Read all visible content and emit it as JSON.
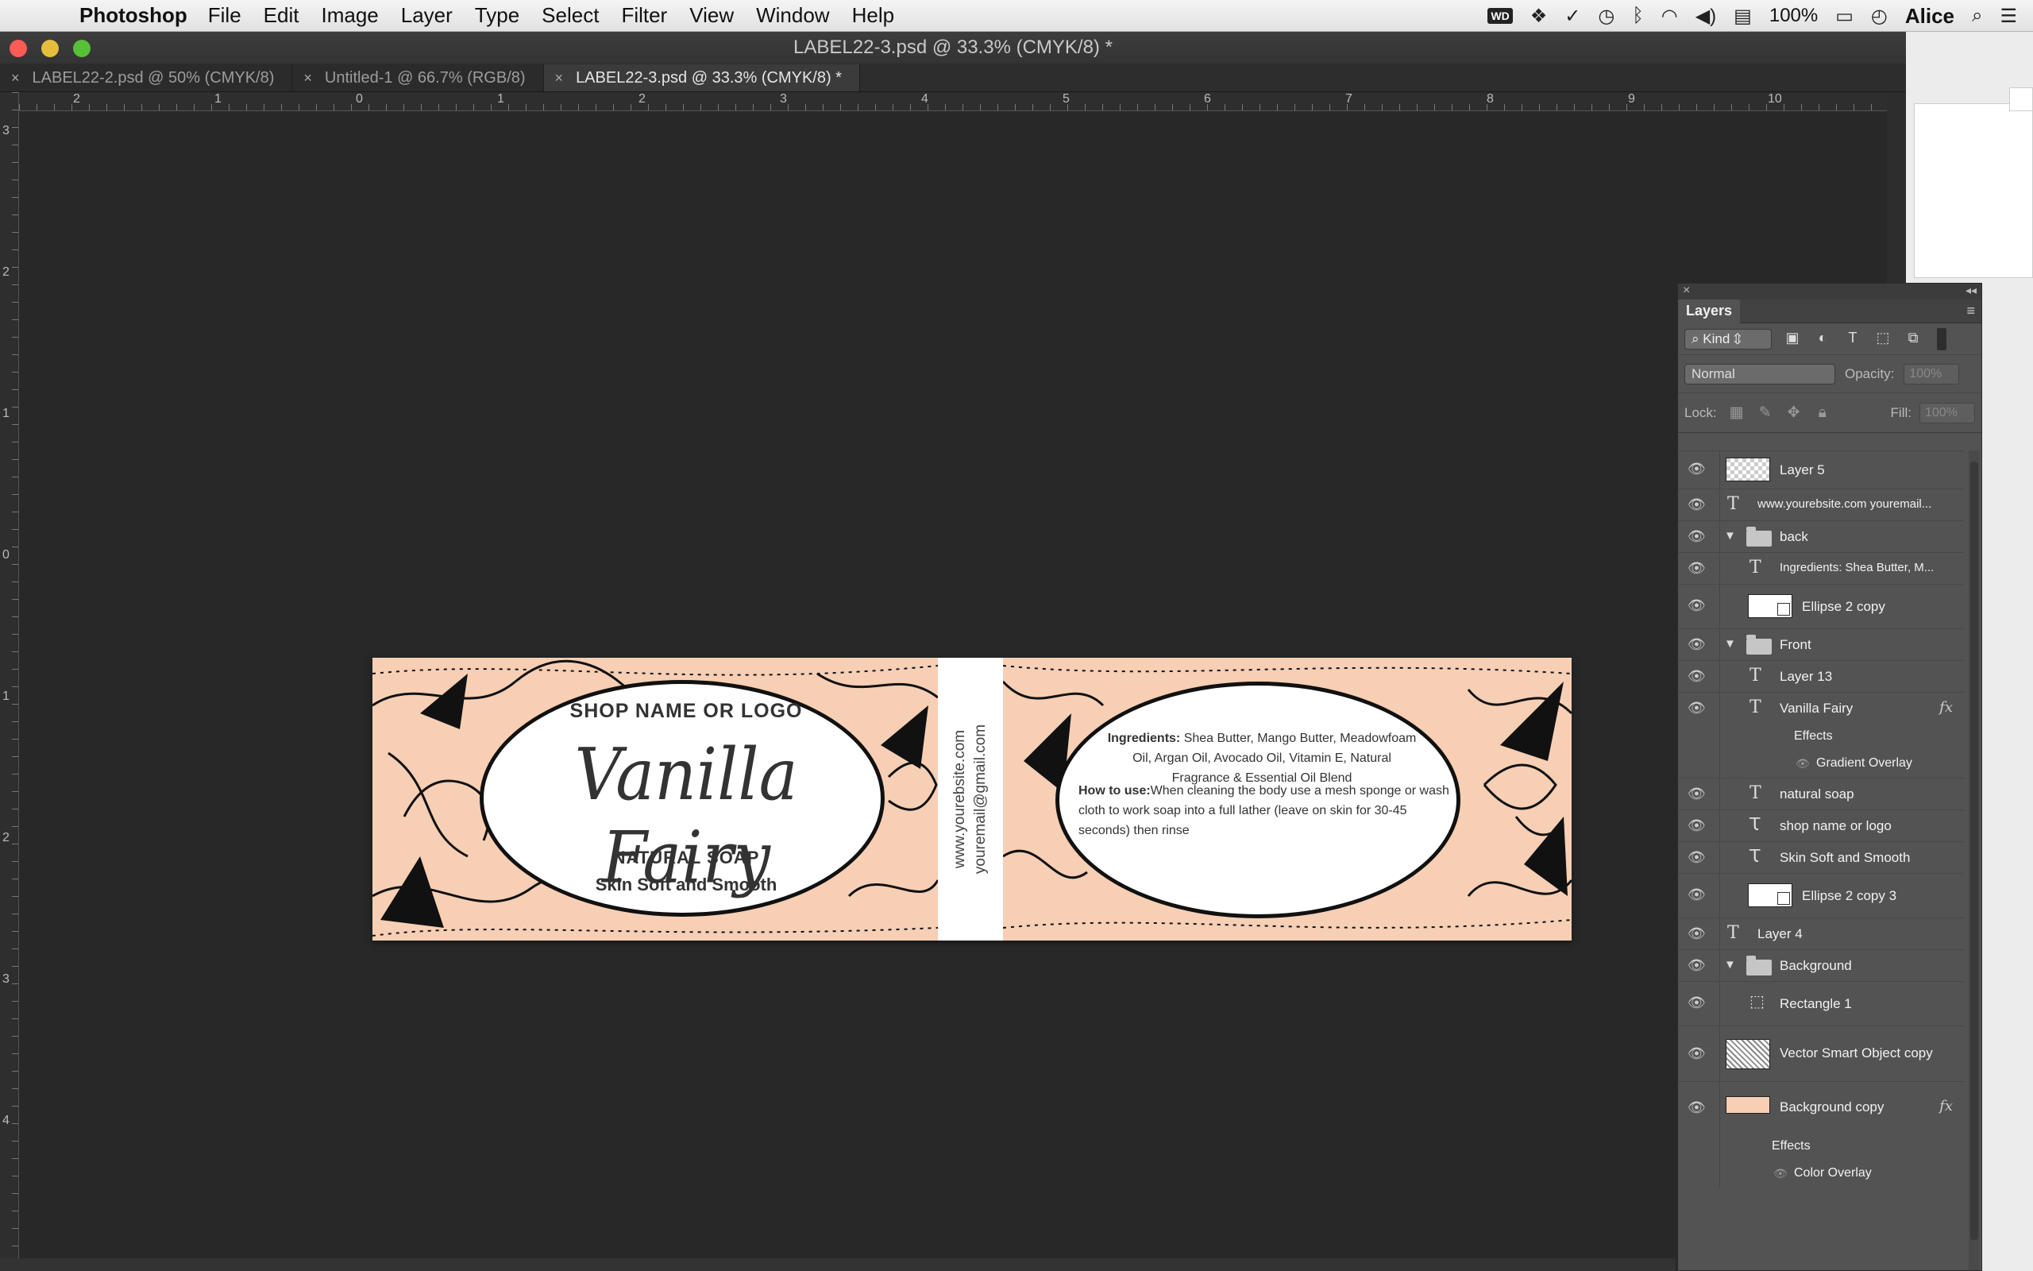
{
  "menubar": {
    "app_name": "Photoshop",
    "menus": [
      "File",
      "Edit",
      "Image",
      "Layer",
      "Type",
      "Select",
      "Filter",
      "View",
      "Window",
      "Help"
    ],
    "status": {
      "wd_badge": "WD",
      "battery": "100%",
      "user": "Alice"
    }
  },
  "window": {
    "title": "LABEL22-3.psd @ 33.3% (CMYK/8) *"
  },
  "tabs": [
    {
      "label": "LABEL22-2.psd @ 50% (CMYK/8)"
    },
    {
      "label": "Untitled-1 @ 66.7% (RGB/8)"
    },
    {
      "label": "LABEL22-3.psd @ 33.3% (CMYK/8) *"
    }
  ],
  "rulers": {
    "top": [
      "2",
      "1",
      "0",
      "1",
      "2",
      "3",
      "4",
      "5",
      "6",
      "7",
      "8",
      "9",
      "10"
    ],
    "left": [
      "3",
      "2",
      "1",
      "0",
      "1",
      "2",
      "3",
      "4"
    ]
  },
  "label": {
    "front": {
      "shop_name": "SHOP NAME OR LOGO",
      "product_name": "Vanilla Fairy",
      "soap_type": "NATURAL SOAP",
      "tagline": "Skin Soft and Smooth"
    },
    "spine": {
      "website": "www.yourebsite.com",
      "email": "youremail@gmail.com"
    },
    "back": {
      "ingredients_label": "Ingredients:",
      "ingredients_text": " Shea Butter, Mango Butter, Meadowfoam Oil, Argan Oil, Avocado Oil, Vitamin E, Natural Fragrance & Essential Oil Blend",
      "how_to_label": "How to use:",
      "how_to_text": "When cleaning the body use a mesh sponge or wash cloth to work soap into a full lather (leave on skin for 30-45 seconds) then rinse"
    }
  },
  "layers_panel": {
    "title": "Layers",
    "filter_kind": "Kind",
    "blend_mode": "Normal",
    "opacity_label": "Opacity:",
    "opacity_value": "100%",
    "lock_label": "Lock:",
    "fill_label": "Fill:",
    "fill_value": "100%",
    "layers": [
      {
        "name": "Layer 5"
      },
      {
        "name": "www.yourebsite.com youremail..."
      },
      {
        "name": "back"
      },
      {
        "name": "Ingredients: Shea Butter, M..."
      },
      {
        "name": "Ellipse 2 copy"
      },
      {
        "name": "Front"
      },
      {
        "name": "Layer 13"
      },
      {
        "name": "Vanilla Fairy"
      },
      {
        "name": "Effects"
      },
      {
        "name": "Gradient Overlay"
      },
      {
        "name": "natural soap"
      },
      {
        "name": "shop name or logo"
      },
      {
        "name": "Skin Soft and Smooth"
      },
      {
        "name": "Ellipse 2 copy 3"
      },
      {
        "name": "Layer 4"
      },
      {
        "name": "Background"
      },
      {
        "name": "Rectangle 1"
      },
      {
        "name": "Vector Smart Object copy"
      },
      {
        "name": "Background copy"
      },
      {
        "name": "Effects"
      },
      {
        "name": "Color Overlay"
      }
    ],
    "fx_label": "fx"
  },
  "colors": {
    "label_peach": "#f7cfb4",
    "canvas_bg": "#282828",
    "panel_bg": "#535353"
  }
}
